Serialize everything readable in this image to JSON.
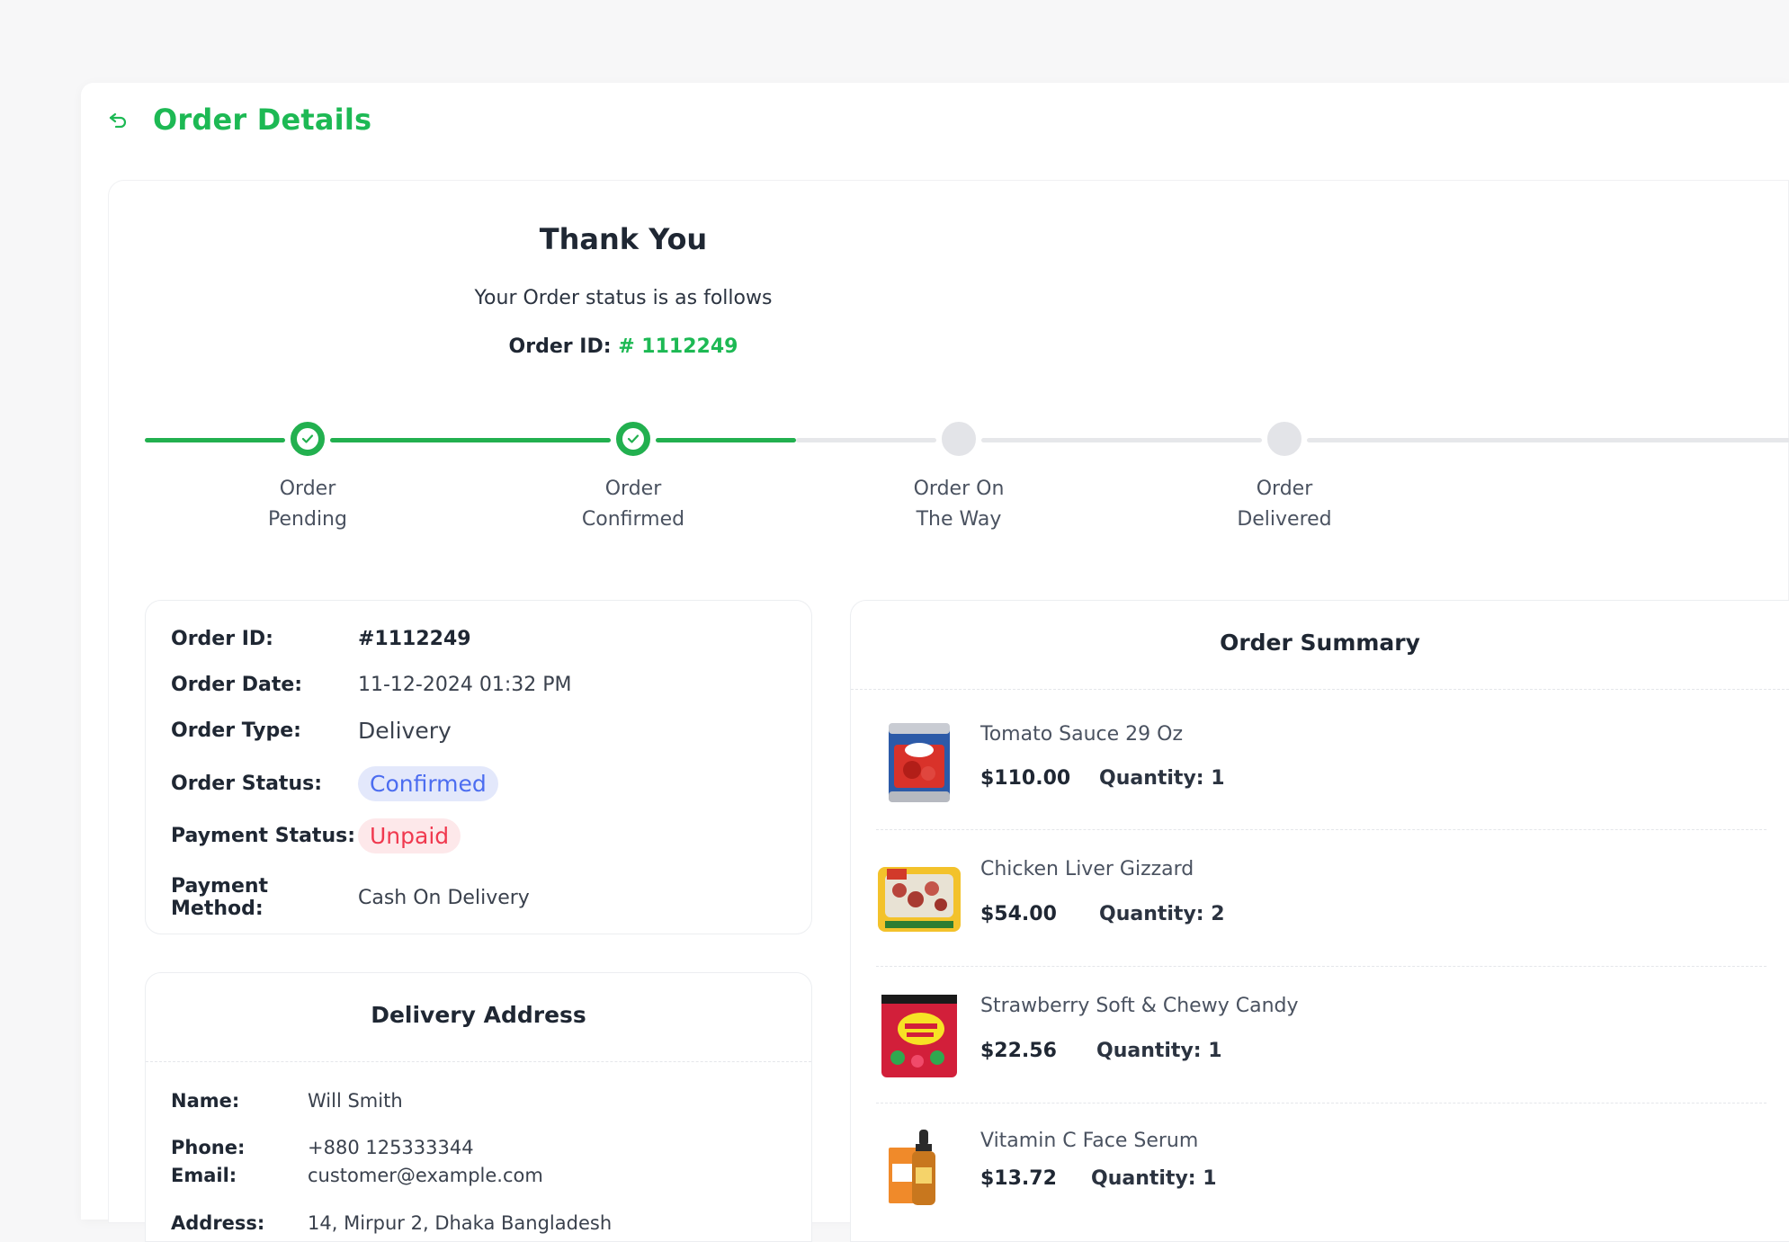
{
  "header": {
    "title": "Order Details",
    "back_icon": "undo-arrow-icon"
  },
  "colors": {
    "accent": "#1db954",
    "progress_done": "#22b04f",
    "confirmed_badge": "#4c6df0",
    "unpaid_badge": "#f0394f"
  },
  "thanks": {
    "title": "Thank You",
    "subtitle": "Your Order status is as follows",
    "order_id_label": "Order ID:",
    "order_id_value": "# 1112249"
  },
  "tracker": {
    "steps": [
      {
        "line1": "Order",
        "line2": "Pending",
        "state": "done"
      },
      {
        "line1": "Order",
        "line2": "Confirmed",
        "state": "done"
      },
      {
        "line1": "Order On",
        "line2": "The Way",
        "state": "todo"
      },
      {
        "line1": "Order",
        "line2": "Delivered",
        "state": "todo"
      }
    ]
  },
  "order_info": {
    "order_id_label": "Order ID:",
    "order_id": "#1112249",
    "order_date_label": "Order Date:",
    "order_date": "11-12-2024 01:32 PM",
    "order_type_label": "Order Type:",
    "order_type": "Delivery",
    "order_status_label": "Order Status:",
    "order_status": "Confirmed",
    "payment_status_label": "Payment Status:",
    "payment_status": "Unpaid",
    "payment_method_label": "Payment Method:",
    "payment_method": "Cash On Delivery"
  },
  "delivery_address": {
    "title": "Delivery Address",
    "name_label": "Name:",
    "name": "Will Smith",
    "phone_label": "Phone:",
    "phone": "+880 125333344",
    "email_label": "Email:",
    "email": "customer@example.com",
    "address_label": "Address:",
    "address": "14, Mirpur 2, Dhaka Bangladesh"
  },
  "order_summary": {
    "title": "Order Summary",
    "items": [
      {
        "name": "Tomato Sauce 29 Oz",
        "price": "$110.00",
        "quantity": "Quantity: 1",
        "image": "tomato-sauce-can"
      },
      {
        "name": "Chicken Liver Gizzard",
        "price": "$54.00",
        "quantity": "Quantity: 2",
        "image": "chicken-liver-pack"
      },
      {
        "name": "Strawberry Soft & Chewy Candy",
        "price": "$22.56",
        "quantity": "Quantity: 1",
        "image": "candy-bag"
      },
      {
        "name": "Vitamin C Face Serum",
        "price": "$13.72",
        "quantity": "Quantity: 1",
        "image": "serum-bottle"
      }
    ]
  }
}
